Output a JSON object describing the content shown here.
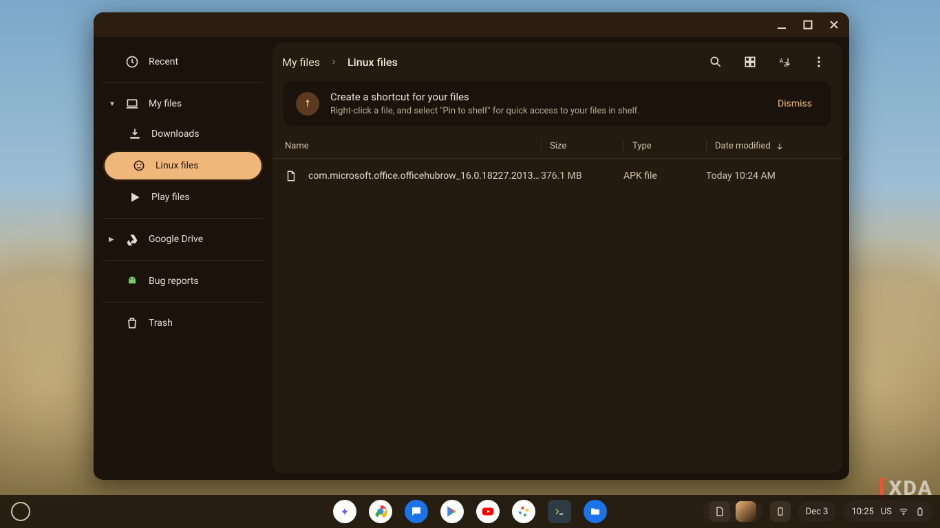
{
  "sidebar": {
    "recent": "Recent",
    "myfiles": "My files",
    "downloads": "Downloads",
    "linux": "Linux files",
    "play": "Play files",
    "drive": "Google Drive",
    "bugs": "Bug reports",
    "trash": "Trash"
  },
  "breadcrumb": {
    "root": "My files",
    "current": "Linux files"
  },
  "banner": {
    "title": "Create a shortcut for your files",
    "desc": "Right-click a file, and select \"Pin to shelf\" for quick access to your files in shelf.",
    "dismiss": "Dismiss"
  },
  "columns": {
    "name": "Name",
    "size": "Size",
    "type": "Type",
    "modified": "Date modified"
  },
  "files": [
    {
      "name": "com.microsoft.office.officehubrow_16.0.18227.20130-443…",
      "size": "376.1 MB",
      "type": "APK file",
      "modified": "Today 10:24 AM"
    }
  ],
  "shelf": {
    "date": "Dec 3",
    "time": "10:25",
    "locale": "US"
  },
  "watermark": "XDA"
}
